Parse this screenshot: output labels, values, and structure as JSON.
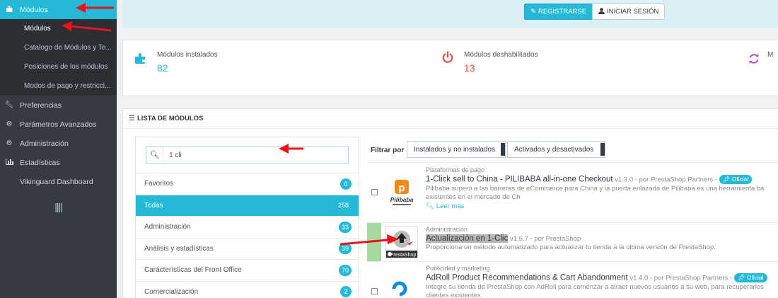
{
  "sidebar": {
    "modules_label": "Módulos",
    "sub_items": [
      {
        "label": "Módulos"
      },
      {
        "label": "Catalogo de Módulos y Te..."
      },
      {
        "label": "Posiciones de los módulos"
      },
      {
        "label": "Modos de pago y restricci..."
      }
    ],
    "items": [
      {
        "label": "Preferencias",
        "icon": "wrench-icon"
      },
      {
        "label": "Parámetros Avanzados",
        "icon": "gears-icon"
      },
      {
        "label": "Administración",
        "icon": "gear-icon"
      },
      {
        "label": "Estadísticas",
        "icon": "bar-chart-icon"
      },
      {
        "label": "Vikinguard Dashboard",
        "icon": ""
      }
    ],
    "collapse_glyph": "||||"
  },
  "banner": {
    "register_label": "REGISTRARSE",
    "login_label": "INICIAR SESIÓN"
  },
  "kpis": {
    "installed_label": "Módulos instalados",
    "installed_value": "82",
    "disabled_label": "Módulos deshabilitados",
    "disabled_value": "13",
    "third_label": "M"
  },
  "module_list": {
    "title": "LISTA DE MÓDULOS",
    "search_value": "1 cli",
    "categories": [
      {
        "label": "Favoritos",
        "count": "0"
      },
      {
        "label": "Todas",
        "count": "258"
      },
      {
        "label": "Administración",
        "count": "33"
      },
      {
        "label": "Análisis y estadísticas",
        "count": "39"
      },
      {
        "label": "Carácterísticas del Front Office",
        "count": "70"
      },
      {
        "label": "Comercialización",
        "count": "2"
      }
    ],
    "filter_label": "Filtrar por",
    "filter_install": "Instalados y no instalados",
    "filter_active": "Activados y desactivados",
    "modules": [
      {
        "category": "Plataformas de pago",
        "name": "1-Click sell to China - PILIBABA all-in-one Checkout",
        "meta": " v1.3.0 - por PrestaShop Partners - ",
        "badge": "Oficial",
        "desc_line1": "Pilibaba superó a las barreras de eCommerce para China y la puerta enlazada de Pilibaba es una herramienta bá",
        "desc_line2": "existentes en el mercado de Ch",
        "more": "Leer más",
        "logo_text": "Pilibaba"
      },
      {
        "category": "Administración",
        "name": "Actualización en 1-Clic",
        "meta": " v1.6.7 - por PrestaShop",
        "desc_line1": "Proporciona un método automatizado para actualizar tu tienda a la última versión de PrestaShop.",
        "logo_text": "PrestaShop"
      },
      {
        "category": "Publicidad y marketing",
        "name": "AdRoll Product Recommendations & Cart Abandonment",
        "meta": " v1.4.0 - por PrestaShop Partners - ",
        "badge": "Oficial",
        "desc_line1": "Integre su tienda de PrestaShop con AdRoll para comenzar a atraer nuevos usuarios a su web, para recuperarlos",
        "desc_line2": "clientes existentes"
      }
    ]
  },
  "colors": {
    "accent": "#25b9d7",
    "sidebar": "#363a41",
    "danger": "#e84e3c",
    "arrow": "#e8141c"
  }
}
